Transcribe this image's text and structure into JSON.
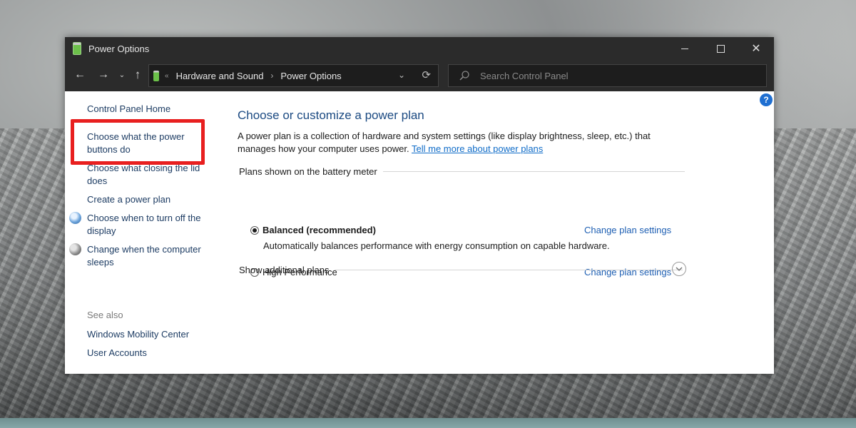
{
  "window": {
    "title": "Power Options"
  },
  "titlebar": {
    "close_glyph": "✕"
  },
  "nav": {
    "back": "←",
    "forward": "→",
    "recent": "⌄",
    "up": "↑"
  },
  "address": {
    "overflow_marker": "«",
    "crumbs": [
      "Hardware and Sound",
      "Power Options"
    ],
    "chevron": "›",
    "dropdown": "⌄",
    "refresh": "⟳"
  },
  "search": {
    "placeholder": "Search Control Panel"
  },
  "help": {
    "label": "?"
  },
  "sidebar": {
    "items": [
      {
        "label": "Control Panel Home"
      },
      {
        "label": "Choose what the power buttons do"
      },
      {
        "label": "Choose what closing the lid does"
      },
      {
        "label": "Create a power plan"
      },
      {
        "label": "Choose when to turn off the display"
      },
      {
        "label": "Change when the computer sleeps"
      }
    ],
    "see_also_label": "See also",
    "see_also": [
      {
        "label": "Windows Mobility Center"
      },
      {
        "label": "User Accounts"
      }
    ]
  },
  "main": {
    "heading": "Choose or customize a power plan",
    "description": "A power plan is a collection of hardware and system settings (like display brightness, sleep, etc.) that manages how your computer uses power. ",
    "description_link": "Tell me more about power plans",
    "group_label": "Plans shown on the battery meter",
    "plans": [
      {
        "name": "Balanced (recommended)",
        "selected": true,
        "description": "Automatically balances performance with energy consumption on capable hardware.",
        "link": "Change plan settings"
      },
      {
        "name": "High Performance",
        "selected": false,
        "description": "",
        "link": "Change plan settings"
      }
    ],
    "additional_label": "Show additional plans"
  },
  "colors": {
    "accent_link": "#1e5fb3",
    "heading": "#1b4a82",
    "highlight_box": "#e81f1f",
    "titlebar": "#2b2b2b"
  }
}
